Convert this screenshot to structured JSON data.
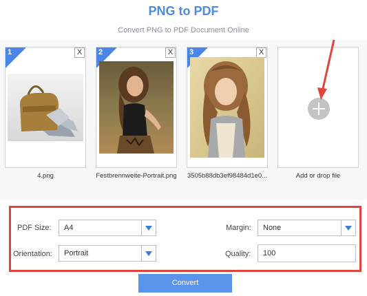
{
  "header": {
    "title": "PNG to PDF",
    "subtitle": "Convert PNG to PDF Document Online"
  },
  "files": [
    {
      "index": "1",
      "name": "4.png",
      "close": "X"
    },
    {
      "index": "2",
      "name": "Festbrennweite-Portrait.png",
      "close": "X"
    },
    {
      "index": "3",
      "name": "3505b88db3ef98484d1e0...",
      "close": "X"
    }
  ],
  "add_file": {
    "label": "Add or drop file",
    "icon": "plus-icon"
  },
  "settings": {
    "pdf_size_label": "PDF Size:",
    "pdf_size_value": "A4",
    "orientation_label": "Orientation:",
    "orientation_value": "Portrait",
    "margin_label": "Margin:",
    "margin_value": "None",
    "quality_label": "Quality:",
    "quality_value": "100"
  },
  "convert_label": "Convert",
  "colors": {
    "accent": "#4a86e8",
    "highlight": "#e0443e"
  }
}
